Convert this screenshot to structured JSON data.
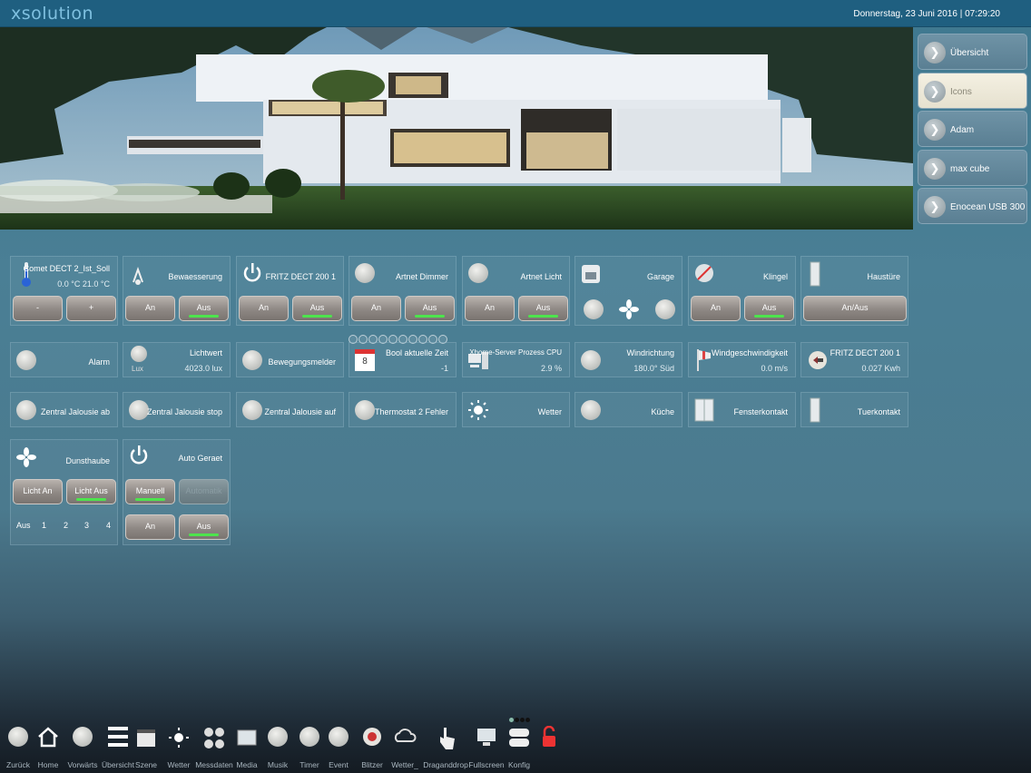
{
  "header": {
    "logo": "xsolution",
    "datetime": "Donnerstag, 23 Juni 2016  |  07:29:20"
  },
  "rooms": [
    {
      "label": "Übersicht",
      "active": false
    },
    {
      "label": "Icons",
      "active": true
    },
    {
      "label": "Adam",
      "active": false
    },
    {
      "label": "max cube",
      "active": false
    },
    {
      "label": "Enocean USB 300",
      "active": false
    }
  ],
  "tiles": {
    "comet": {
      "title": "Comet DECT  2_Ist_Soll",
      "value": "0.0 °C   21.0 °C",
      "minus": "-",
      "plus": "+"
    },
    "bewaesserung": {
      "title": "Bewaesserung",
      "on": "An",
      "off": "Aus"
    },
    "fritz1": {
      "title": "FRITZ DECT 200  1",
      "on": "An",
      "off": "Aus"
    },
    "dimmer": {
      "title": "Artnet Dimmer",
      "on": "An",
      "off": "Aus"
    },
    "licht": {
      "title": "Artnet Licht",
      "on": "An",
      "off": "Aus"
    },
    "garage": {
      "title": "Garage"
    },
    "klingel": {
      "title": "Klingel",
      "on": "An",
      "off": "Aus"
    },
    "haustuere": {
      "title": "Haustüre",
      "toggle": "An/Aus"
    },
    "alarm": {
      "title": "Alarm"
    },
    "lichtwert": {
      "title": "Lichtwert",
      "value": "4023.0 lux",
      "icon_label": "Lux"
    },
    "bewegung": {
      "title": "Bewegungsmelder"
    },
    "boolzeit": {
      "title": "Bool aktuelle Zeit",
      "value": "-1",
      "cal_day": "8"
    },
    "cpu": {
      "title": "Xhome-Server Prozess CPU",
      "value": "2.9 %"
    },
    "wind": {
      "title": "Windrichtung",
      "value": "180.0° Süd"
    },
    "windspeed": {
      "title": "Windgeschwindigkeit",
      "value": "0.0 m/s"
    },
    "fritz2": {
      "title": "FRITZ DECT 200  1",
      "value": "0.027 Kwh"
    },
    "jal_ab": {
      "title": "Zentral Jalousie ab"
    },
    "jal_stop": {
      "title": "Zentral Jalousie stop"
    },
    "jal_auf": {
      "title": "Zentral Jalousie auf"
    },
    "thermostat": {
      "title": "Thermostat 2 Fehler"
    },
    "wetter": {
      "title": "Wetter"
    },
    "kueche": {
      "title": "Küche"
    },
    "fenster": {
      "title": "Fensterkontakt"
    },
    "tuer": {
      "title": "Tuerkontakt"
    },
    "dunst": {
      "title": "Dunsthaube",
      "licht_an": "Licht An",
      "licht_aus": "Licht Aus",
      "levels": [
        "Aus",
        "1",
        "2",
        "3",
        "4"
      ]
    },
    "auto": {
      "title": "Auto Geraet",
      "manuell": "Manuell",
      "automatik": "Automatik",
      "on": "An",
      "off": "Aus"
    }
  },
  "footer": [
    {
      "label": "Zurück",
      "icon": "back-icon"
    },
    {
      "label": "Home",
      "icon": "home-icon"
    },
    {
      "label": "Vorwärts",
      "icon": "forward-icon"
    },
    {
      "label": "Übersicht",
      "icon": "list-icon"
    },
    {
      "label": "Szene",
      "icon": "scene-icon"
    },
    {
      "label": "Wetter",
      "icon": "sun-icon"
    },
    {
      "label": "Messdaten",
      "icon": "gauges-icon"
    },
    {
      "label": "Media",
      "icon": "media-icon"
    },
    {
      "label": "Musik",
      "icon": "music-icon"
    },
    {
      "label": "Timer",
      "icon": "timer-icon"
    },
    {
      "label": "Event",
      "icon": "event-icon"
    },
    {
      "label": "Blitzer",
      "icon": "blitzer-icon"
    },
    {
      "label": "Wetter_",
      "icon": "cloud-icon"
    },
    {
      "label": "Draganddrop",
      "icon": "hand-icon"
    },
    {
      "label": "Fullscreen",
      "icon": "fullscreen-icon"
    },
    {
      "label": "Konfig",
      "icon": "config-icon"
    },
    {
      "label": "",
      "icon": "lock-icon"
    }
  ],
  "colors": {
    "on_indicator": "#4de44d",
    "topbar": "#1f5f80"
  }
}
